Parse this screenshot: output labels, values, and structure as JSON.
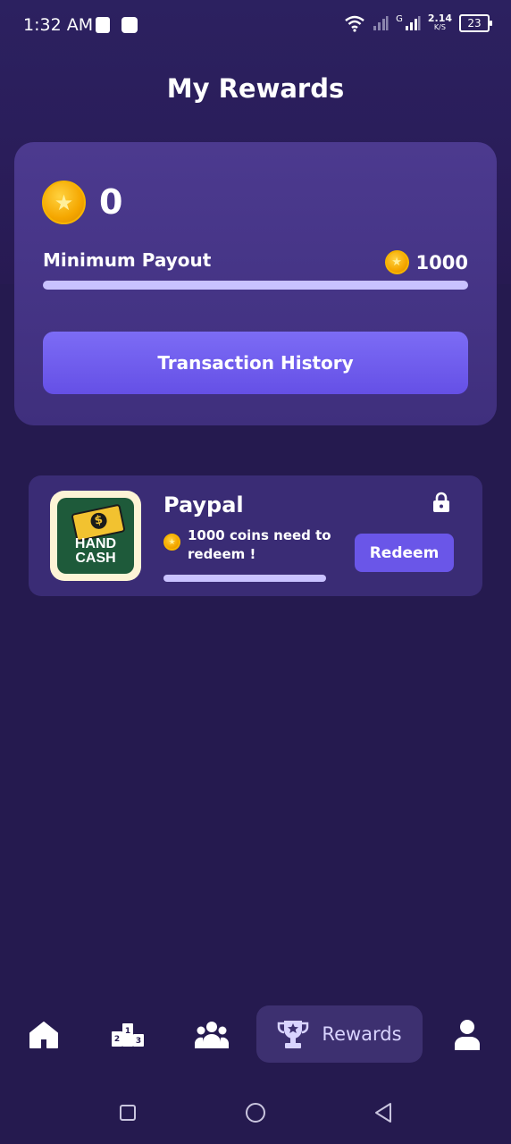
{
  "status_bar": {
    "time": "1:32 AM",
    "network_type": "G",
    "net_speed_value": "2.14",
    "net_speed_unit": "K/S",
    "battery": "23"
  },
  "page": {
    "title": "My Rewards"
  },
  "balance_card": {
    "balance": "0",
    "min_payout_label": "Minimum Payout",
    "min_payout_value": "1000",
    "progress_fraction": 0.0,
    "transaction_button_label": "Transaction History"
  },
  "reward_item": {
    "name": "Paypal",
    "thumbnail_text_line1": "HAND",
    "thumbnail_text_line2": "CASH",
    "thumbnail_currency_symbol": "$",
    "note": "1000 coins need to redeem !",
    "progress_fraction": 0.0,
    "redeem_label": "Redeem",
    "locked": true
  },
  "bottom_nav": {
    "items": [
      {
        "icon": "home-icon"
      },
      {
        "icon": "leaderboard-icon"
      },
      {
        "icon": "community-icon"
      },
      {
        "icon": "trophy-icon",
        "label": "Rewards",
        "active": true
      },
      {
        "icon": "profile-icon"
      }
    ]
  },
  "colors": {
    "background": "#251a4f",
    "card": "#3f2f7d",
    "accent": "#6a56e8",
    "progress_track": "#c9c2ff",
    "coin": "#f5a700"
  }
}
